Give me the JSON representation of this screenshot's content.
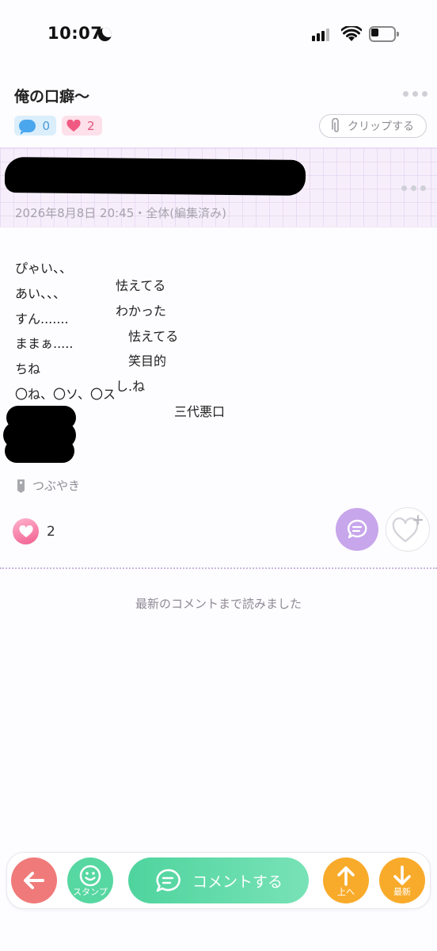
{
  "status_bar": {
    "time": "10:07"
  },
  "header": {
    "title": "俺の口癖〜",
    "comment_count": "0",
    "like_count": "2",
    "clip_label": "クリップする"
  },
  "post": {
    "meta": "2026年8月8日 20:45・全体(編集済み)",
    "lines": [
      {
        "left": "ぴゃい、、",
        "right": "怯えてる"
      },
      {
        "left": "あい、、、",
        "right": "わかった"
      },
      {
        "left": "すん.......",
        "right": "怯えてる"
      },
      {
        "left": "ままぁ.....",
        "right": "笑目的"
      },
      {
        "left": "ちね",
        "right": "し.ね"
      },
      {
        "left": "〇ね、〇ソ、〇ス",
        "right": "三代悪口"
      }
    ],
    "tag": "つぶやき",
    "like_count": "2"
  },
  "read_notice": "最新のコメントまで読みました",
  "bottom_bar": {
    "stamp_label": "スタンプ",
    "comment_label": "コメントする",
    "up_label": "上へ",
    "latest_label": "最新"
  },
  "colors": {
    "accent_purple": "#c7a6ec",
    "comment_green": "#57d7a1",
    "back_red": "#f07a7a",
    "nav_orange": "#f8ab2b",
    "like_pink": "#e25580"
  },
  "icons": [
    "moon-icon",
    "signal-icon",
    "wifi-icon",
    "battery-icon",
    "comment-bubble-icon",
    "heart-icon",
    "paperclip-icon",
    "tag-icon",
    "smile-icon",
    "arrow-left-icon",
    "arrow-up-icon",
    "arrow-down-icon",
    "heart-plus-icon"
  ]
}
